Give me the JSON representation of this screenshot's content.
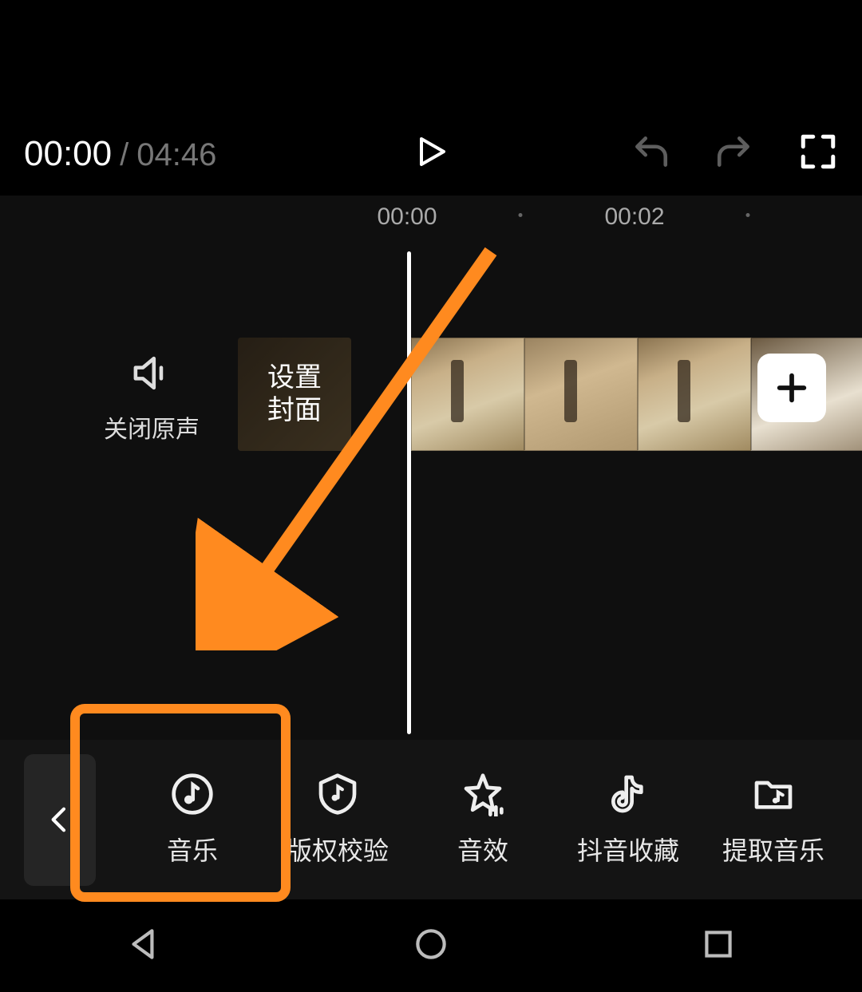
{
  "player": {
    "current_time": "00:00",
    "separator": "/",
    "total_time": "04:46"
  },
  "ruler": {
    "tick0": "00:00",
    "tick2": "00:02"
  },
  "track": {
    "mute_label": "关闭原声",
    "cover_label": "设置\n封面"
  },
  "tools": {
    "music": "音乐",
    "copyright": "版权校验",
    "sfx": "音效",
    "favorites": "抖音收藏",
    "extract": "提取音乐"
  },
  "annotation": {
    "highlight_target": "音乐"
  }
}
